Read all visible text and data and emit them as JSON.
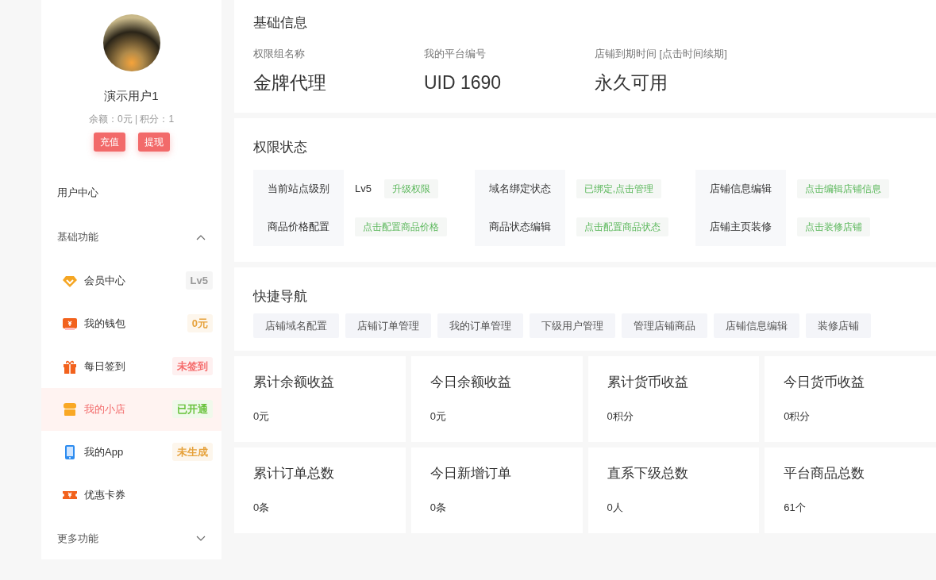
{
  "user": {
    "name": "演示用户1",
    "balance_line": "余额：0元 | 积分：1",
    "buttons": [
      "充值",
      "提现"
    ]
  },
  "sidebar": {
    "top_link": "用户中心",
    "groups": [
      {
        "title": "基础功能",
        "expanded": true,
        "items": [
          {
            "label": "会员中心",
            "badge": "Lv5",
            "color": "#999999",
            "selected": false
          },
          {
            "label": "我的钱包",
            "badge": "0元",
            "color": "#e6a23c",
            "selected": false
          },
          {
            "label": "每日签到",
            "badge": "未签到",
            "color": "#f56c6c",
            "selected": false
          },
          {
            "label": "我的小店",
            "badge": "已开通",
            "color": "#67c23a",
            "selected": true
          },
          {
            "label": "我的App",
            "badge": "未生成",
            "color": "#e6a23c",
            "selected": false
          },
          {
            "label": "优惠卡券",
            "selected": false
          }
        ]
      },
      {
        "title": "更多功能",
        "expanded": false
      }
    ]
  },
  "basic_info": {
    "title": "基础信息",
    "fields": [
      {
        "label": "权限组名称",
        "value": "金牌代理"
      },
      {
        "label": "我的平台编号",
        "value": "UID 1690"
      },
      {
        "label": "店铺到期时间 [点击时间续期]",
        "value": "永久可用"
      }
    ]
  },
  "permission_status": {
    "title": "权限状态",
    "groups": [
      {
        "rows": [
          {
            "label": "当前站点级别",
            "text": "Lv5",
            "action": "升级权限"
          },
          {
            "label": "商品价格配置",
            "action": "点击配置商品价格"
          }
        ]
      },
      {
        "rows": [
          {
            "label": "域名绑定状态",
            "action": "已绑定,点击管理"
          },
          {
            "label": "商品状态编辑",
            "action": "点击配置商品状态"
          }
        ]
      },
      {
        "rows": [
          {
            "label": "店铺信息编辑",
            "action": "点击编辑店铺信息"
          },
          {
            "label": "店铺主页装修",
            "action": "点击装修店铺"
          }
        ]
      }
    ]
  },
  "quick_nav": {
    "title": "快捷导航",
    "links": [
      "店铺域名配置",
      "店铺订单管理",
      "我的订单管理",
      "下级用户管理",
      "管理店铺商品",
      "店铺信息编辑",
      "装修店铺"
    ]
  },
  "stats": [
    {
      "title": "累计余额收益",
      "value": "0元"
    },
    {
      "title": "今日余额收益",
      "value": "0元"
    },
    {
      "title": "累计货币收益",
      "value": "0积分"
    },
    {
      "title": "今日货币收益",
      "value": "0积分"
    },
    {
      "title": "累计订单总数",
      "value": "0条"
    },
    {
      "title": "今日新增订单",
      "value": "0条"
    },
    {
      "title": "直系下级总数",
      "value": "0人"
    },
    {
      "title": "平台商品总数",
      "value": "61个"
    }
  ]
}
